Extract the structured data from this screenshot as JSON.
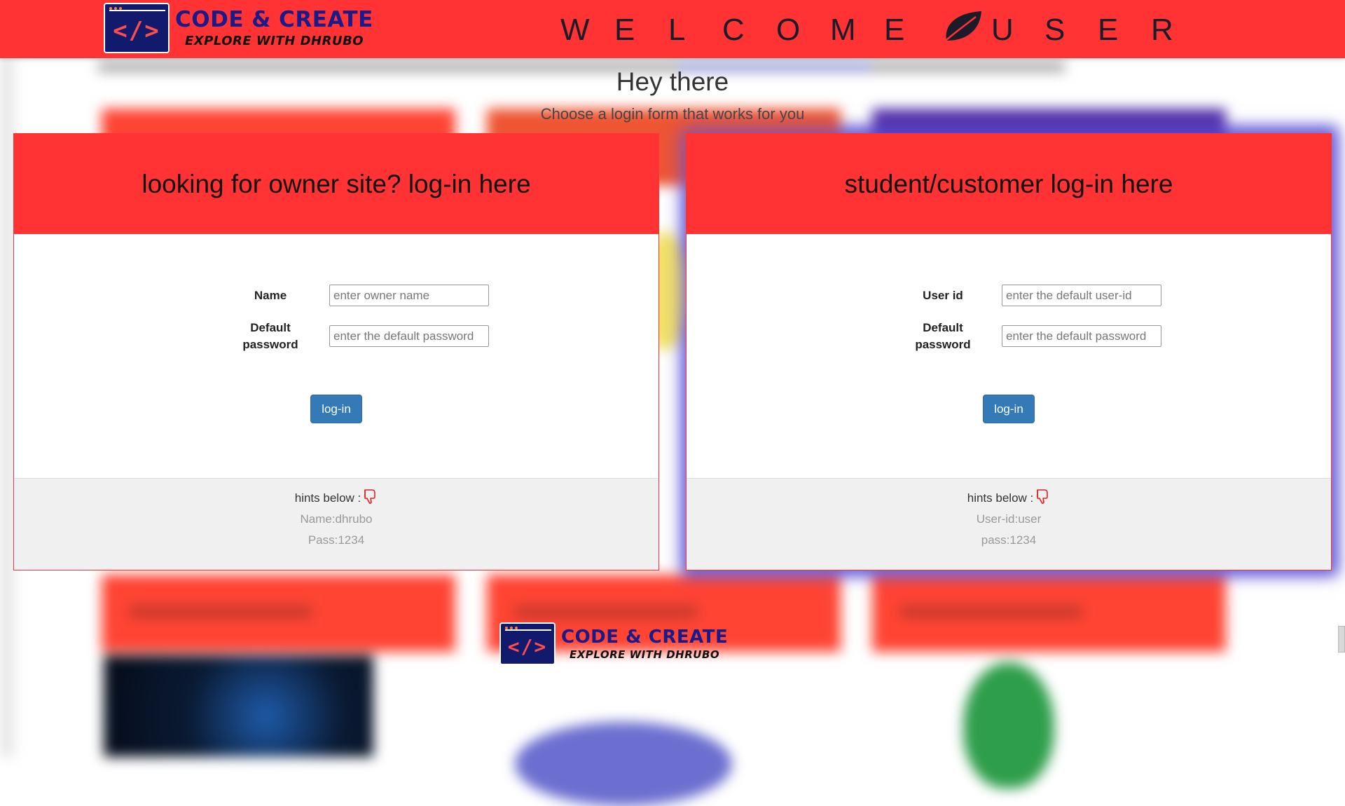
{
  "brand": {
    "title": "CODE & CREATE",
    "subtitle": "EXPLORE WITH DHRUBO",
    "logo_glyph": "</>",
    "primary_color": "#ff3333",
    "logo_bg": "#121a6e"
  },
  "header": {
    "welcome_word1": [
      "W",
      "E",
      "L",
      "C",
      "O",
      "M",
      "E"
    ],
    "welcome_word2": [
      "U",
      "S",
      "E",
      "R"
    ],
    "leaf_icon": "leaf-icon"
  },
  "greeting": {
    "title": "Hey there",
    "subtitle": "Choose a login form that works for you"
  },
  "owner_panel": {
    "heading": "looking for owner site? log-in here",
    "field1_label": "Name",
    "field1_placeholder": "enter owner name",
    "field2_label": "Default password",
    "field2_placeholder": "enter the default password",
    "button": "log-in",
    "hint_title": "hints below :",
    "hint_line1": "Name:dhrubo",
    "hint_line2": "Pass:1234"
  },
  "student_panel": {
    "heading": "student/customer log-in here",
    "field1_label": "User id",
    "field1_placeholder": "enter the default user-id",
    "field2_label": "Default password",
    "field2_placeholder": "enter the default password",
    "button": "log-in",
    "hint_title": "hints below :",
    "hint_line1": "User-id:user",
    "hint_line2": "pass:1234"
  },
  "button_color": "#337ab7",
  "footer_bg": "#f0f0f0"
}
